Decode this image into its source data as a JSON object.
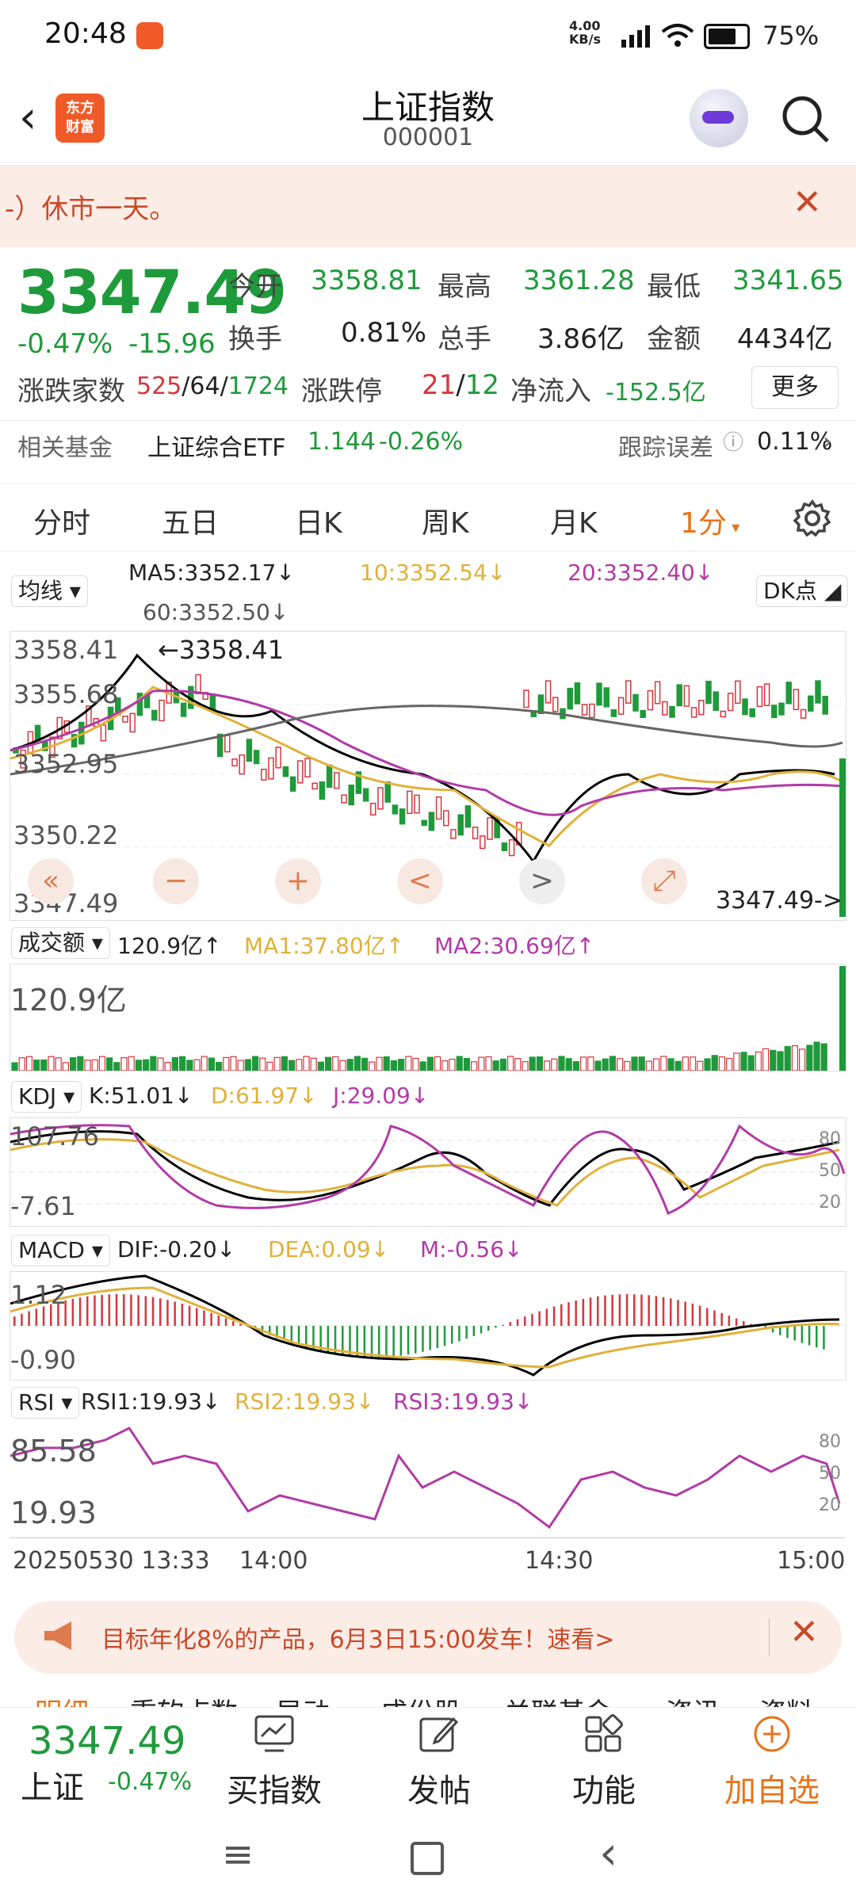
{
  "status": {
    "time": "20:48",
    "net_speed": "4.00",
    "net_unit": "KB/s",
    "battery": "75%"
  },
  "header": {
    "logo": "东方\n财富",
    "title": "上证指数",
    "code": "000001"
  },
  "notice": {
    "text": "-）休市一天。"
  },
  "quote": {
    "price": "3347.49",
    "change_pct": "-0.47%",
    "change": "-15.96",
    "open_label": "今开",
    "open": "3358.81",
    "high_label": "最高",
    "high": "3361.28",
    "low_label": "最低",
    "low": "3341.65",
    "turnover_label": "换手",
    "turnover": "0.81%",
    "volume_label": "总手",
    "volume": "3.86亿",
    "amount_label": "金额",
    "amount": "4434亿",
    "breadth_label": "涨跌家数",
    "breadth_up": "525",
    "breadth_flat": "64",
    "breadth_down": "1724",
    "limit_label": "涨跌停",
    "limit_up": "21",
    "limit_down": "12",
    "netflow_label": "净流入",
    "netflow": "-152.5亿",
    "more": "更多"
  },
  "fund": {
    "label": "相关基金",
    "name": "上证综合ETF",
    "price": "1.144",
    "pct": "-0.26%",
    "tracking_label": "跟踪误差",
    "tracking": "0.11%"
  },
  "tabs": [
    "分时",
    "五日",
    "日K",
    "周K",
    "月K",
    "1分"
  ],
  "kline": {
    "indicator": "均线",
    "ma5": "MA5:3352.17",
    "ma10": "10:3352.54",
    "ma20": "20:3352.40",
    "ma60": "60:3352.50",
    "dk": "DK点",
    "y_labels": [
      "3358.41",
      "3355.68",
      "3352.95",
      "3350.22",
      "3347.49"
    ],
    "high_marker": "←3358.41",
    "last_marker": "3347.49->",
    "zoom_buttons": [
      "«",
      "−",
      "+",
      "<",
      ">",
      "⤢"
    ]
  },
  "volume": {
    "indicator": "成交额",
    "value": "120.9亿",
    "ma1": "MA1:37.80亿",
    "ma2": "MA2:30.69亿",
    "y_label": "120.9亿"
  },
  "kdj": {
    "indicator": "KDJ",
    "k": "K:51.01",
    "d": "D:61.97",
    "j": "J:29.09",
    "y_top": "107.76",
    "y_bottom": "-7.61",
    "levels": [
      "80",
      "50",
      "20"
    ]
  },
  "macd": {
    "indicator": "MACD",
    "dif": "DIF:-0.20",
    "dea": "DEA:0.09",
    "m": "M:-0.56",
    "y_top": "1.12",
    "y_bottom": "-0.90"
  },
  "rsi": {
    "indicator": "RSI",
    "rsi1": "RSI1:19.93",
    "rsi2": "RSI2:19.93",
    "rsi3": "RSI3:19.93",
    "y_top": "85.58",
    "y_bottom": "19.93",
    "levels": [
      "80",
      "50",
      "20"
    ]
  },
  "time_axis": [
    "20250530 13:33",
    "14:00",
    "14:30",
    "15:00"
  ],
  "ad": {
    "text": "目标年化8%的产品，6月3日15:00发车！速看>"
  },
  "subtabs": [
    "明细",
    "重软点数",
    "异动",
    "成份股",
    "关联基金",
    "资讯",
    "资料"
  ],
  "bottom": {
    "price": "3347.49",
    "name": "上证",
    "pct": "-0.47%",
    "buy": "买指数",
    "post": "发帖",
    "func": "功能",
    "add": "加自选"
  },
  "colors": {
    "up": "#d4373d",
    "down": "#1f9a3b",
    "accent": "#e8731a",
    "ma10": "#e0b13a",
    "ma20": "#b23aa6"
  }
}
